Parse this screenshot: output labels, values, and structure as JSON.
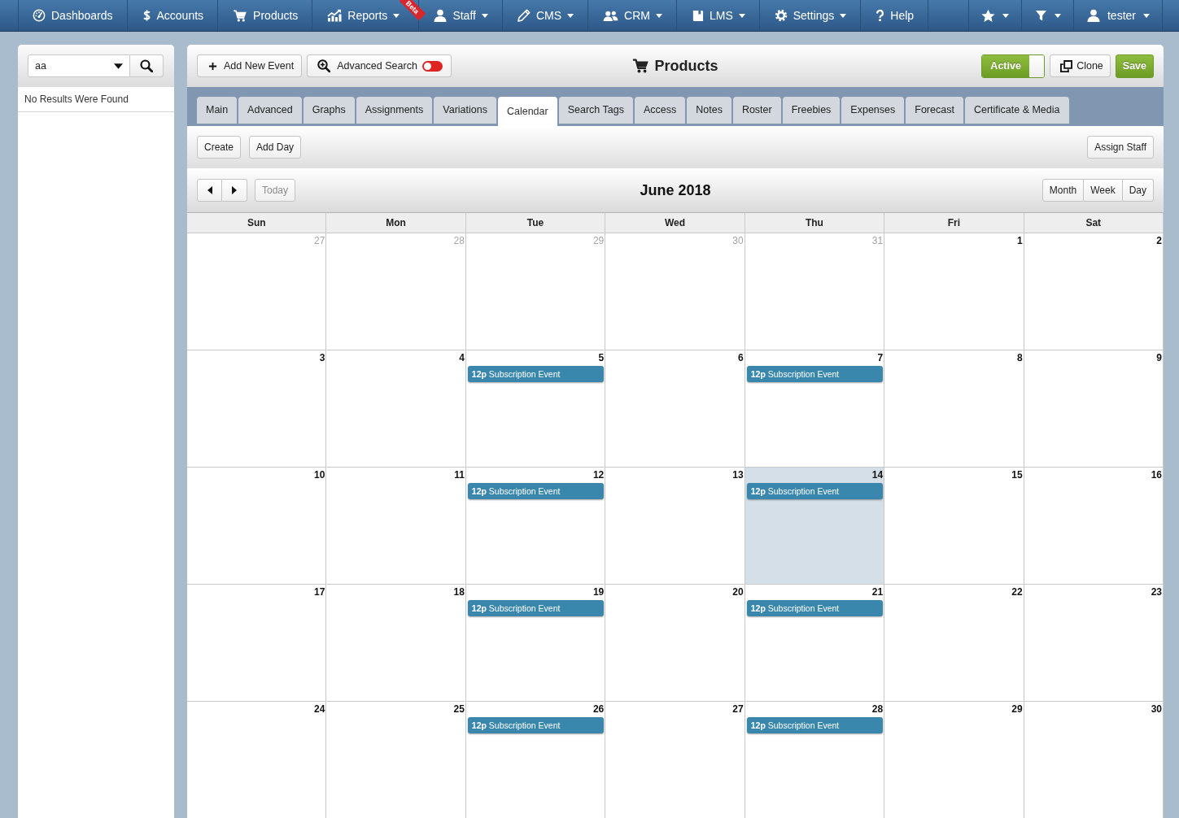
{
  "top_nav": {
    "items": [
      {
        "label": "Dashboards",
        "dropdown": false
      },
      {
        "label": "Accounts",
        "dropdown": false
      },
      {
        "label": "Products",
        "dropdown": false
      },
      {
        "label": "Reports",
        "dropdown": true,
        "ribbon": "Beta"
      },
      {
        "label": "Staff",
        "dropdown": true
      },
      {
        "label": "CMS",
        "dropdown": true
      },
      {
        "label": "CRM",
        "dropdown": true
      },
      {
        "label": "LMS",
        "dropdown": true
      },
      {
        "label": "Settings",
        "dropdown": true
      },
      {
        "label": "Help",
        "dropdown": false
      }
    ],
    "right_items": [
      {
        "dropdown": true
      },
      {
        "dropdown": true
      },
      {
        "label": "tester",
        "dropdown": true
      }
    ]
  },
  "sidebar": {
    "search": {
      "value": "aa"
    },
    "message": "No Results Were Found"
  },
  "header": {
    "add_button": "Add New Event",
    "advanced_search": {
      "label": "Advanced Search",
      "on": false
    },
    "title": "Products",
    "status_toggle": {
      "label": "Active",
      "on": true
    },
    "clone_button": "Clone",
    "save_button": "Save"
  },
  "tabs": [
    {
      "label": "Main",
      "selected": false
    },
    {
      "label": "Advanced",
      "selected": false
    },
    {
      "label": "Graphs",
      "selected": false
    },
    {
      "label": "Assignments",
      "selected": false
    },
    {
      "label": "Variations",
      "selected": false
    },
    {
      "label": "Calendar",
      "selected": true
    },
    {
      "label": "Search Tags",
      "selected": false
    },
    {
      "label": "Access",
      "selected": false
    },
    {
      "label": "Notes",
      "selected": false
    },
    {
      "label": "Roster",
      "selected": false
    },
    {
      "label": "Freebies",
      "selected": false
    },
    {
      "label": "Expenses",
      "selected": false
    },
    {
      "label": "Forecast",
      "selected": false
    },
    {
      "label": "Certificate & Media",
      "selected": false
    }
  ],
  "toolbar": {
    "left": [
      "Create",
      "Add Day"
    ],
    "right": [
      "Assign Staff"
    ]
  },
  "calendar": {
    "today_button": {
      "label": "Today",
      "disabled": true
    },
    "title": "June 2018",
    "views": [
      {
        "label": "Month",
        "selected": false
      },
      {
        "label": "Week",
        "selected": false
      },
      {
        "label": "Day",
        "selected": false
      }
    ],
    "weekdays": [
      "Sun",
      "Mon",
      "Tue",
      "Wed",
      "Thu",
      "Fri",
      "Sat"
    ],
    "weeks": [
      [
        {
          "day": "27",
          "other_month": true,
          "today": false
        },
        {
          "day": "28",
          "other_month": true,
          "today": false
        },
        {
          "day": "29",
          "other_month": true,
          "today": false
        },
        {
          "day": "30",
          "other_month": true,
          "today": false
        },
        {
          "day": "31",
          "other_month": true,
          "today": false
        },
        {
          "day": "1",
          "other_month": false,
          "today": false
        },
        {
          "day": "2",
          "other_month": false,
          "today": false
        }
      ],
      [
        {
          "day": "3",
          "other_month": false,
          "today": false
        },
        {
          "day": "4",
          "other_month": false,
          "today": false
        },
        {
          "day": "5",
          "other_month": false,
          "today": false,
          "events": [
            {
              "time": "12p",
              "title": "Subscription Event"
            }
          ]
        },
        {
          "day": "6",
          "other_month": false,
          "today": false
        },
        {
          "day": "7",
          "other_month": false,
          "today": false,
          "events": [
            {
              "time": "12p",
              "title": "Subscription Event"
            }
          ]
        },
        {
          "day": "8",
          "other_month": false,
          "today": false
        },
        {
          "day": "9",
          "other_month": false,
          "today": false
        }
      ],
      [
        {
          "day": "10",
          "other_month": false,
          "today": false
        },
        {
          "day": "11",
          "other_month": false,
          "today": false
        },
        {
          "day": "12",
          "other_month": false,
          "today": false,
          "events": [
            {
              "time": "12p",
              "title": "Subscription Event"
            }
          ]
        },
        {
          "day": "13",
          "other_month": false,
          "today": false
        },
        {
          "day": "14",
          "other_month": false,
          "today": true,
          "events": [
            {
              "time": "12p",
              "title": "Subscription Event"
            }
          ]
        },
        {
          "day": "15",
          "other_month": false,
          "today": false
        },
        {
          "day": "16",
          "other_month": false,
          "today": false
        }
      ],
      [
        {
          "day": "17",
          "other_month": false,
          "today": false
        },
        {
          "day": "18",
          "other_month": false,
          "today": false
        },
        {
          "day": "19",
          "other_month": false,
          "today": false,
          "events": [
            {
              "time": "12p",
              "title": "Subscription Event"
            }
          ]
        },
        {
          "day": "20",
          "other_month": false,
          "today": false
        },
        {
          "day": "21",
          "other_month": false,
          "today": false,
          "events": [
            {
              "time": "12p",
              "title": "Subscription Event"
            }
          ]
        },
        {
          "day": "22",
          "other_month": false,
          "today": false
        },
        {
          "day": "23",
          "other_month": false,
          "today": false
        }
      ],
      [
        {
          "day": "24",
          "other_month": false,
          "today": false
        },
        {
          "day": "25",
          "other_month": false,
          "today": false
        },
        {
          "day": "26",
          "other_month": false,
          "today": false,
          "events": [
            {
              "time": "12p",
              "title": "Subscription Event"
            }
          ]
        },
        {
          "day": "27",
          "other_month": false,
          "today": false
        },
        {
          "day": "28",
          "other_month": false,
          "today": false,
          "events": [
            {
              "time": "12p",
              "title": "Subscription Event"
            }
          ]
        },
        {
          "day": "29",
          "other_month": false,
          "today": false
        },
        {
          "day": "30",
          "other_month": false,
          "today": false
        }
      ]
    ]
  }
}
